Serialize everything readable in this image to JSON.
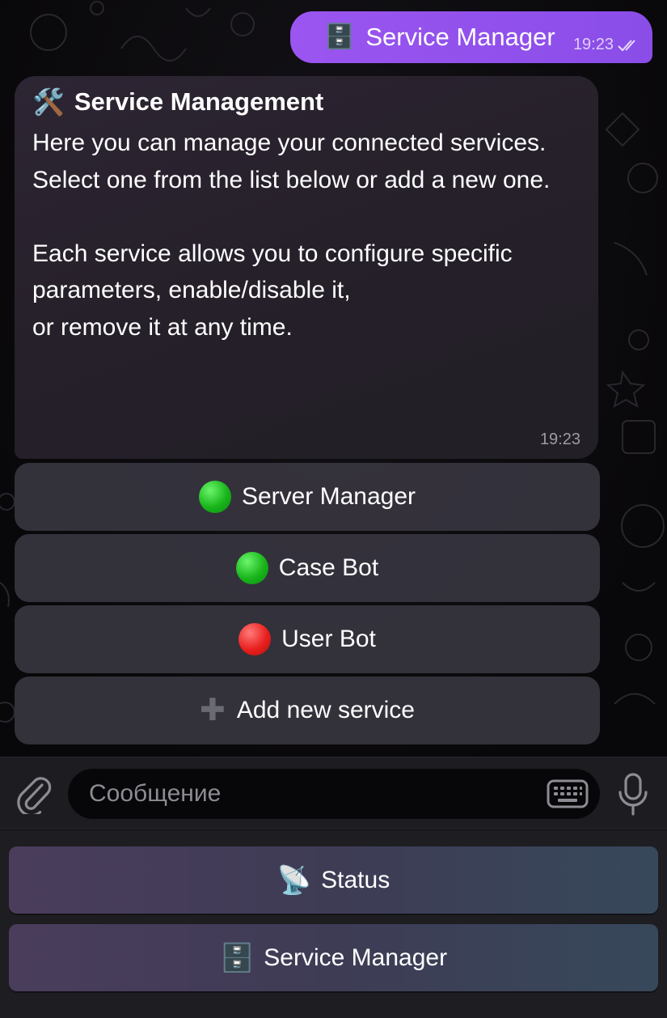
{
  "outgoing_message": {
    "emoji": "🗄️",
    "text": "Service Manager",
    "time": "19:23"
  },
  "incoming_message": {
    "title_emoji": "🛠️",
    "title": "Service Management",
    "body": "Here you can manage your connected services.\nSelect one from the list below or add a new one.\n\nEach service allows you to configure specific parameters, enable/disable it,\nor remove it at any time.",
    "time": "19:23"
  },
  "inline_buttons": [
    {
      "label": "Server Manager",
      "status": "green"
    },
    {
      "label": "Case Bot",
      "status": "green"
    },
    {
      "label": "User Bot",
      "status": "red"
    },
    {
      "label": "Add new service",
      "icon": "plus-icon"
    }
  ],
  "input": {
    "placeholder": "Сообщение"
  },
  "reply_keyboard": [
    {
      "emoji": "📡",
      "label": "Status"
    },
    {
      "emoji": "🗄️",
      "label": "Service Manager"
    }
  ],
  "colors": {
    "outgoing_bubble": "#9b55f0",
    "incoming_bubble": "#2b2431",
    "status_green": "#19b51b",
    "status_red": "#e8201e"
  }
}
